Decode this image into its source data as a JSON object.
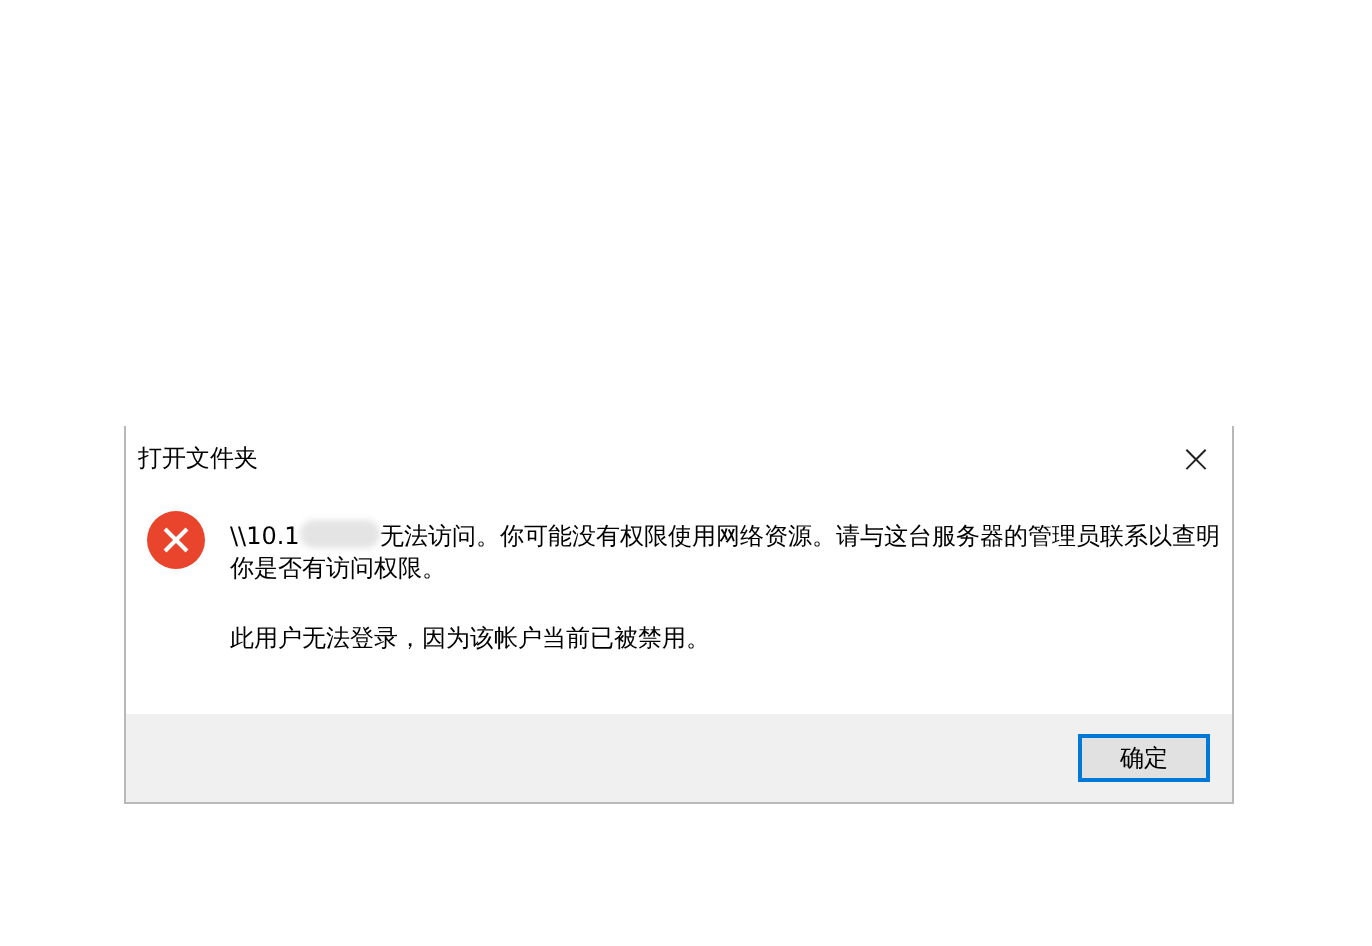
{
  "window": {
    "title": "打开文件夹",
    "close": "×"
  },
  "message": {
    "prefix": "\\\\10.1",
    "redacted": true,
    "rest": "无法访问。你可能没有权限使用网络资源。请与这台服务器的管理员联系以查明你是否有访问权限。",
    "detail": "此用户无法登录，因为该帐户当前已被禁用。"
  },
  "buttons": [
    {
      "label": "确定",
      "selected": true
    }
  ]
}
